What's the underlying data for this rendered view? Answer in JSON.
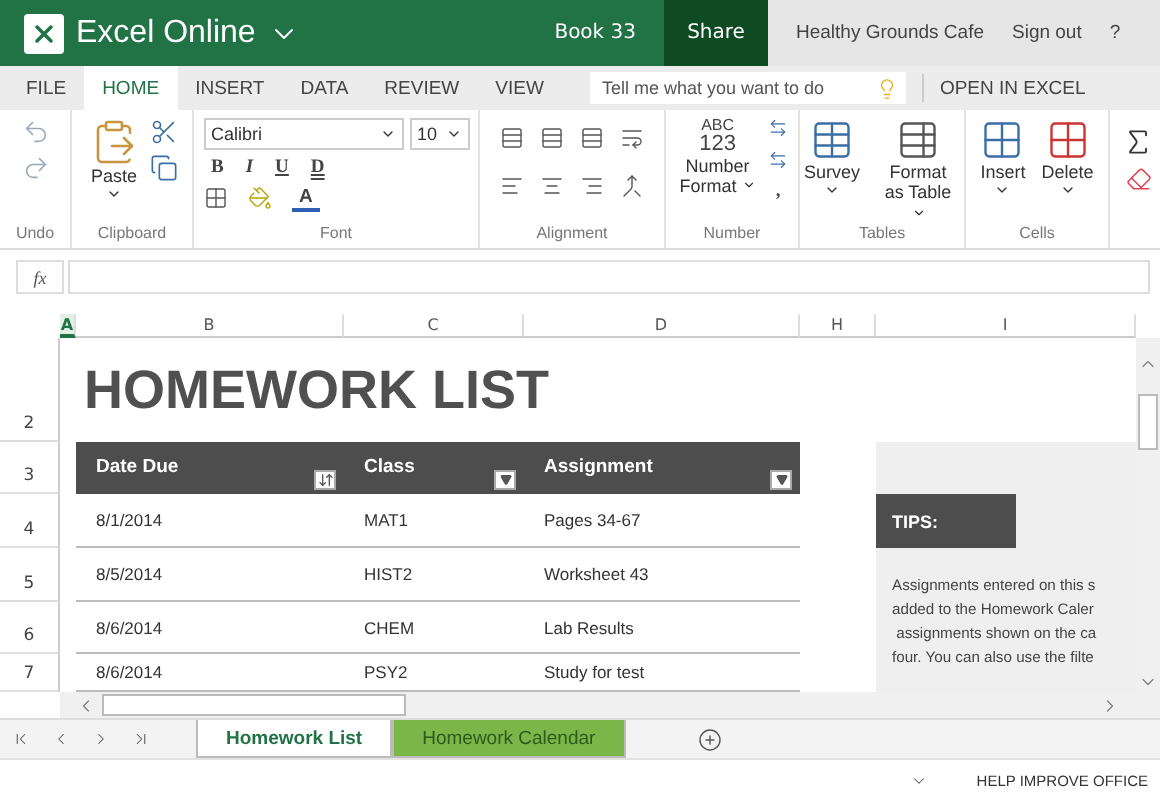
{
  "app": {
    "name": "Excel Online",
    "document": "Book 33",
    "share": "Share",
    "account": "Healthy Grounds Cafe",
    "sign_out": "Sign out",
    "help": "?"
  },
  "tabs": [
    {
      "label": "FILE",
      "selected": false
    },
    {
      "label": "HOME",
      "selected": true
    },
    {
      "label": "INSERT",
      "selected": false
    },
    {
      "label": "DATA",
      "selected": false
    },
    {
      "label": "REVIEW",
      "selected": false
    },
    {
      "label": "VIEW",
      "selected": false
    }
  ],
  "search": {
    "placeholder": "Tell me what you want to do"
  },
  "open_in_excel": "OPEN IN EXCEL",
  "ribbon": {
    "font_name": "Calibri",
    "font_size": "10",
    "bold": "B",
    "italic": "I",
    "underline": "U",
    "double_underline": "D",
    "font_color": "A",
    "number_icon": [
      "ABC",
      "123"
    ],
    "comma": ",",
    "paste": "Paste",
    "number_format": [
      "Number",
      "Format"
    ],
    "survey": "Survey",
    "format_as_table": [
      "Format",
      "as Table"
    ],
    "insert": "Insert",
    "delete": "Delete",
    "groups": [
      "Undo",
      "Clipboard",
      "Font",
      "Alignment",
      "Number",
      "Tables",
      "Cells"
    ]
  },
  "formula_bar": {
    "label": "fx"
  },
  "columns": [
    {
      "label": "A",
      "selected": true
    },
    {
      "label": "B",
      "selected": false
    },
    {
      "label": "C",
      "selected": false
    },
    {
      "label": "D",
      "selected": false
    },
    {
      "label": "H",
      "selected": false
    },
    {
      "label": "I",
      "selected": false
    }
  ],
  "row_numbers": [
    "2",
    "3",
    "4",
    "5",
    "6",
    "7"
  ],
  "sheet": {
    "title": "HOMEWORK LIST",
    "table_columns": [
      {
        "label": "Date Due",
        "kind": "sort"
      },
      {
        "label": "Class",
        "kind": "dropdown"
      },
      {
        "label": "Assignment",
        "kind": "dropdown"
      }
    ],
    "rows": [
      [
        "8/1/2014",
        "MAT1",
        "Pages 34-67"
      ],
      [
        "8/5/2014",
        "HIST2",
        "Worksheet 43"
      ],
      [
        "8/6/2014",
        "CHEM",
        "Lab Results"
      ],
      [
        "8/6/2014",
        "PSY2",
        "Study for test"
      ]
    ],
    "tips": {
      "title": "TIPS:",
      "lines": [
        "Assignments entered on this s",
        "added to the Homework Caler",
        " assignments shown on the ca",
        "four. You can also use the filte"
      ]
    }
  },
  "sheet_tabs": [
    {
      "label": "Homework List",
      "selected": true
    },
    {
      "label": "Homework Calendar",
      "selected": false,
      "color": "#7ab648"
    }
  ],
  "status_bar": {
    "text": "HELP IMPROVE OFFICE"
  }
}
